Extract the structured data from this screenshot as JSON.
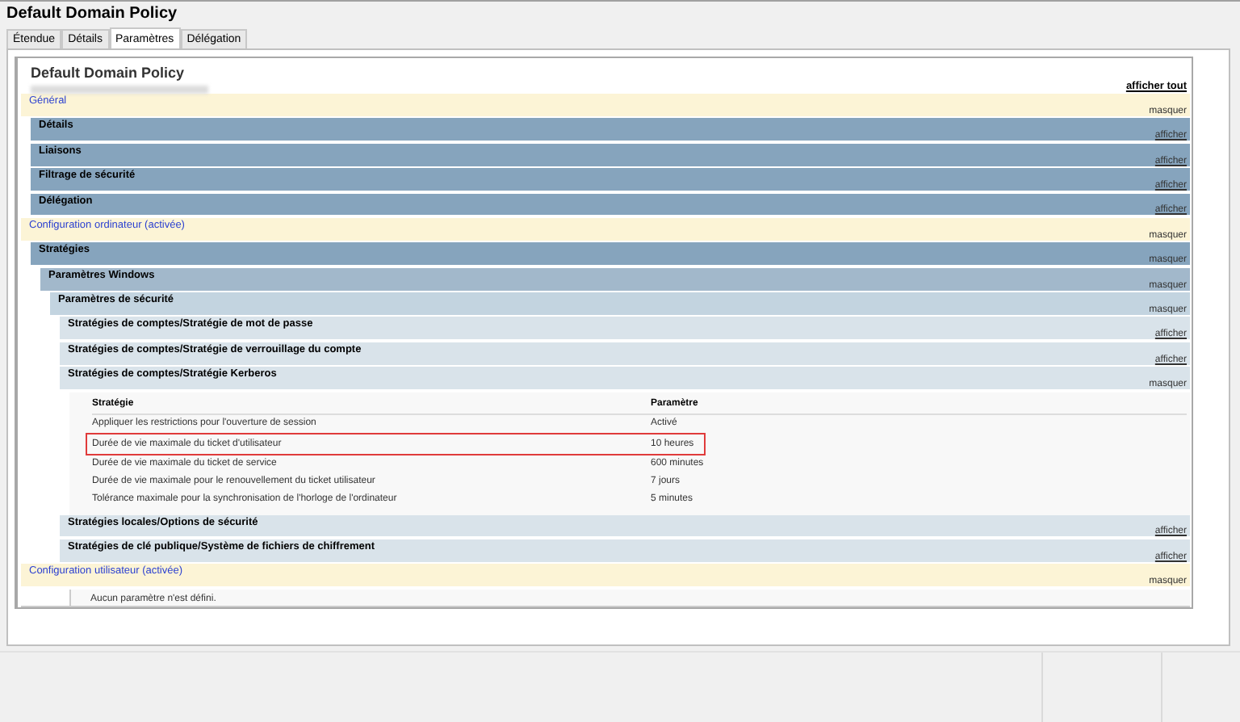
{
  "window": {
    "title": "Default Domain Policy"
  },
  "tabs": [
    {
      "label": "Étendue",
      "selected": false
    },
    {
      "label": "Détails",
      "selected": false
    },
    {
      "label": "Paramètres",
      "selected": true
    },
    {
      "label": "Délégation",
      "selected": false
    }
  ],
  "report": {
    "title": "Default Domain Policy",
    "show_all": "afficher tout",
    "sections": [
      {
        "kind": "category",
        "title": "Général",
        "toggle": "masquer",
        "expanded": true,
        "children": [
          {
            "kind": "section",
            "title": "Détails",
            "toggle": "afficher",
            "expanded": false
          },
          {
            "kind": "section",
            "title": "Liaisons",
            "toggle": "afficher",
            "expanded": false
          },
          {
            "kind": "section",
            "title": "Filtrage de sécurité",
            "toggle": "afficher",
            "expanded": false
          },
          {
            "kind": "section",
            "title": "Délégation",
            "toggle": "afficher",
            "expanded": false
          }
        ]
      },
      {
        "kind": "category",
        "title": "Configuration ordinateur (activée)",
        "toggle": "masquer",
        "expanded": true,
        "children": [
          {
            "kind": "section",
            "title": "Stratégies",
            "toggle": "masquer",
            "expanded": true,
            "children": [
              {
                "kind": "section",
                "title": "Paramètres Windows",
                "toggle": "masquer",
                "expanded": true,
                "children": [
                  {
                    "kind": "section",
                    "title": "Paramètres de sécurité",
                    "toggle": "masquer",
                    "expanded": true,
                    "children": [
                      {
                        "kind": "section",
                        "title": "Stratégies de comptes/Stratégie de mot de passe",
                        "toggle": "afficher",
                        "expanded": false
                      },
                      {
                        "kind": "section",
                        "title": "Stratégies de comptes/Stratégie de verrouillage du compte",
                        "toggle": "afficher",
                        "expanded": false
                      },
                      {
                        "kind": "section",
                        "title": "Stratégies de comptes/Stratégie Kerberos",
                        "toggle": "masquer",
                        "expanded": true,
                        "children": [
                          {
                            "kind": "table",
                            "columns": [
                              "Stratégie",
                              "Paramètre"
                            ],
                            "rows": [
                              {
                                "policy": "Appliquer les restrictions pour l'ouverture de session",
                                "value": "Activé",
                                "highlighted": false
                              },
                              {
                                "policy": "Durée de vie maximale du ticket d'utilisateur",
                                "value": "10 heures",
                                "highlighted": true
                              },
                              {
                                "policy": "Durée de vie maximale du ticket de service",
                                "value": "600 minutes",
                                "highlighted": false
                              },
                              {
                                "policy": "Durée de vie maximale pour le renouvellement du ticket utilisateur",
                                "value": "7 jours",
                                "highlighted": false
                              },
                              {
                                "policy": "Tolérance maximale pour la synchronisation de l'horloge de l'ordinateur",
                                "value": "5 minutes",
                                "highlighted": false
                              }
                            ]
                          }
                        ]
                      },
                      {
                        "kind": "section",
                        "title": "Stratégies locales/Options de sécurité",
                        "toggle": "afficher",
                        "expanded": false
                      },
                      {
                        "kind": "section",
                        "title": "Stratégies de clé publique/Système de fichiers de chiffrement",
                        "toggle": "afficher",
                        "expanded": false
                      }
                    ]
                  }
                ]
              }
            ]
          }
        ]
      },
      {
        "kind": "category",
        "title": "Configuration utilisateur (activée)",
        "toggle": "masquer",
        "expanded": true,
        "children": [
          {
            "kind": "note",
            "text": "Aucun paramètre n'est défini."
          }
        ]
      }
    ]
  }
}
